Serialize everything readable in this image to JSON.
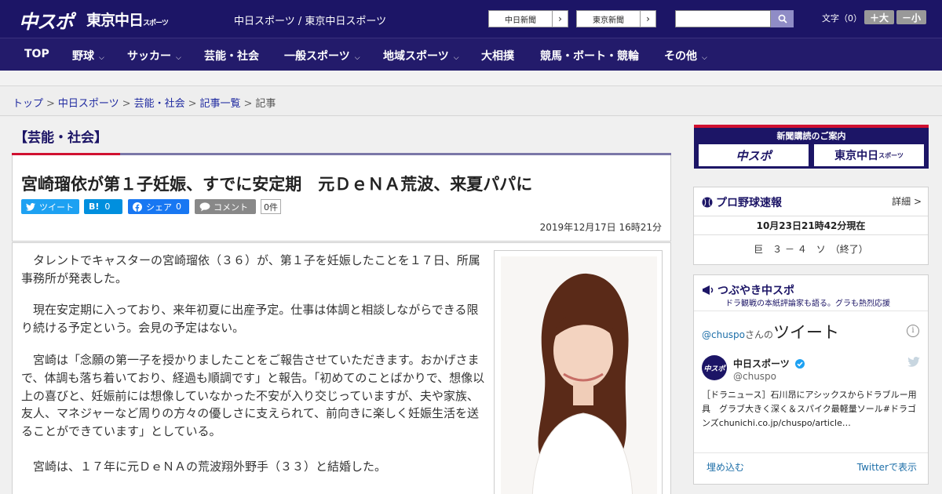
{
  "header": {
    "logo_chuspo": "中スポ",
    "logo_tokyo": "東京中日",
    "logo_tokyo_sub": "スポーツ",
    "site_names": "中日スポーツ / 東京中日スポーツ",
    "link_chunichi": "中日新聞",
    "link_tokyo": "東京新聞",
    "link_arrow": "›",
    "search_placeholder": "",
    "fontsize_label": "文字（0）",
    "fontsize_plus": "＋大",
    "fontsize_minus": "－小"
  },
  "nav": {
    "items": [
      {
        "label": "TOP",
        "has_dropdown": false
      },
      {
        "label": "野球",
        "has_dropdown": true
      },
      {
        "label": "サッカー",
        "has_dropdown": true
      },
      {
        "label": "芸能・社会",
        "has_dropdown": false
      },
      {
        "label": "一般スポーツ",
        "has_dropdown": true
      },
      {
        "label": "地域スポーツ",
        "has_dropdown": true
      },
      {
        "label": "大相撲",
        "has_dropdown": false
      },
      {
        "label": "競馬・ボート・競輪",
        "has_dropdown": false
      },
      {
        "label": "その他",
        "has_dropdown": true
      }
    ],
    "chevron": "⌵"
  },
  "breadcrumb": {
    "items": [
      "トップ",
      "中日スポーツ",
      "芸能・社会",
      "記事一覧",
      "記事"
    ],
    "separator": ">"
  },
  "article": {
    "category": "【芸能・社会】",
    "headline": "宮崎瑠依が第１子妊娠、すでに安定期　元ＤｅＮＡ荒波、来夏パパに",
    "share": {
      "tweet": "ツイート",
      "hatena_icon": "B!",
      "hatena_count": "0",
      "facebook": "シェア",
      "facebook_count": "0",
      "comment": "コメント",
      "comment_count": "0件"
    },
    "date": "2019年12月17日 16時21分",
    "paragraphs": [
      "　タレントでキャスターの宮崎瑠依（３６）が、第１子を妊娠したことを１７日、所属事務所が発表した。",
      "　現在安定期に入っており、来年初夏に出産予定。仕事は体調と相談しながらできる限り続ける予定という。会見の予定はない。",
      "　宮崎は「念願の第一子を授かりましたことをご報告させていただきます。おかげさまで、体調も落ち着いており、経過も順調です」と報告。「初めてのことばかりで、想像以上の喜びと、妊娠前には想像していなかった不安が入り交じっていますが、夫や家族、友人、マネジャーなど周りの方々の優しさに支えられて、前向きに楽しく妊娠生活を送ることができています」としている。",
      "　宮崎は、１７年に元ＤｅＮＡの荒波翔外野手（３３）と結婚した。"
    ]
  },
  "sidebar": {
    "subscribe": {
      "title": "新聞購読のご案内",
      "chuspo": "中スポ",
      "tokyo": "東京中日",
      "tokyo_sub": "スポーツ"
    },
    "baseball": {
      "title": "プロ野球速報",
      "detail": "詳細 >",
      "updated": "10月23日21時42分現在",
      "score": "巨　３ － ４　ソ　（終了）"
    },
    "twitter": {
      "title": "つぶやき中スポ",
      "subtitle": "ドラ観戦の本紙評論家も語る。グラも熱烈応援",
      "handle_line_handle": "@chuspo",
      "handle_line_suffix": "さんの",
      "handle_line_label": "ツイート",
      "info": "i",
      "account_name": "中日スポーツ",
      "account_handle": "@chuspo",
      "avatar_text": "中スポ",
      "tweet": "［ドラニュース］石川昂にアシックスからドラブルー用具　グラブ大きく深く＆スパイク最軽量ソール#ドラゴンズchunichi.co.jp/chuspo/article…",
      "embed": "埋め込む",
      "view_on_twitter": "Twitterで表示"
    }
  },
  "colors": {
    "navy": "#1c1566",
    "red": "#d01030",
    "twitter": "#1da1f2",
    "hatena": "#008fde",
    "facebook": "#1877f2",
    "comment": "#888888"
  }
}
